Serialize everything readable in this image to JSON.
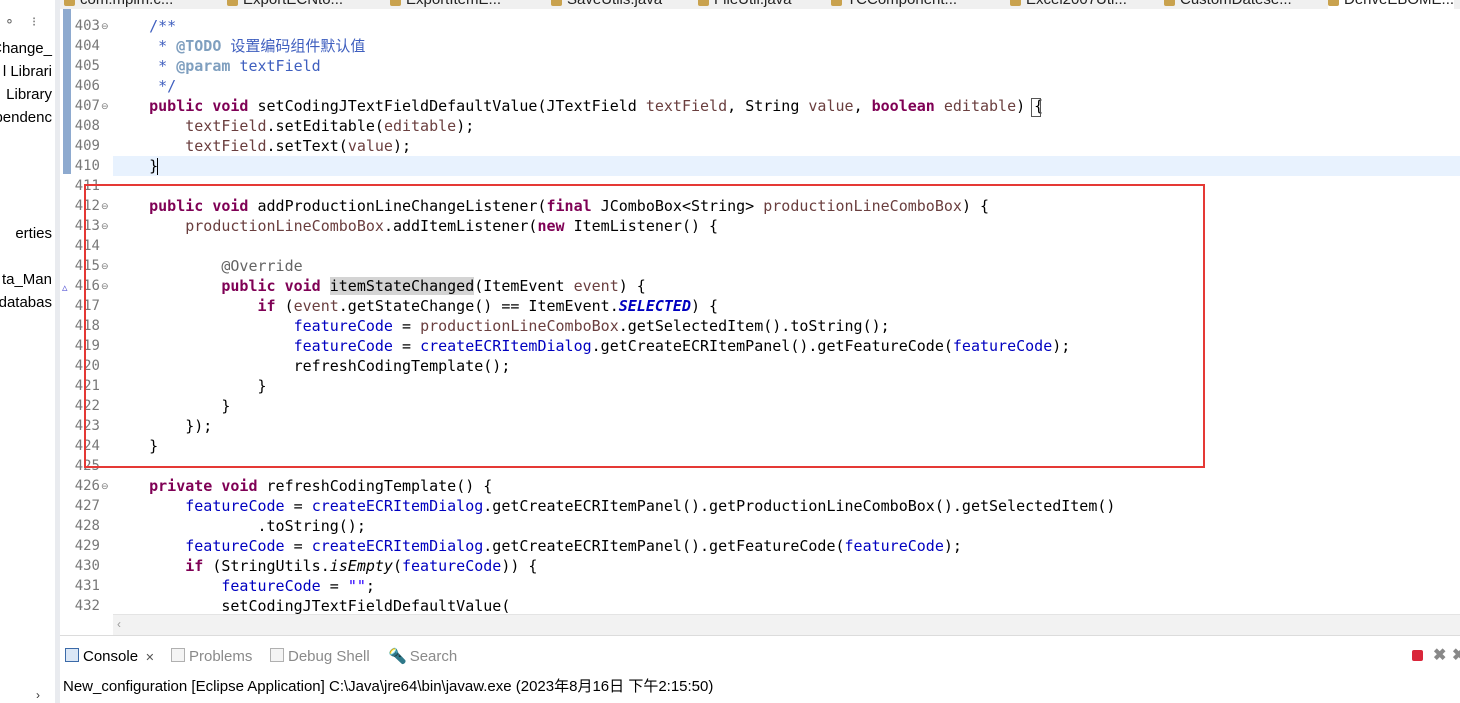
{
  "editor_tabs": [
    {
      "label": "com.mpim.c..."
    },
    {
      "label": "ExportECNto..."
    },
    {
      "label": "ExportItemE..."
    },
    {
      "label": "SaveUtils.java"
    },
    {
      "label": "FileUtil.java"
    },
    {
      "label": "TCComponent..."
    },
    {
      "label": "Excel2007Uti..."
    },
    {
      "label": "CustomDatese..."
    },
    {
      "label": "DeriveEBOME..."
    }
  ],
  "left_tree": [
    {
      "label": "Change_"
    },
    {
      "label": "l Librari"
    },
    {
      "label": "Library"
    },
    {
      "label": "pendenc"
    },
    {
      "label": "erties"
    },
    {
      "label": "ta_Man"
    },
    {
      "label": "databas"
    }
  ],
  "line_numbers": [
    "403",
    "404",
    "405",
    "406",
    "407",
    "408",
    "409",
    "410",
    "411",
    "412",
    "413",
    "414",
    "415",
    "416",
    "417",
    "418",
    "419",
    "420",
    "421",
    "422",
    "423",
    "424",
    "425",
    "426",
    "427",
    "428",
    "429",
    "430",
    "431",
    "432"
  ],
  "code": {
    "l403": "/**",
    "l404_tag": "@TODO",
    "l404_text": "设置编码组件默认值",
    "l405_tag": "@param",
    "l405_param": "textField",
    "l406": "*/",
    "kw_public": "public",
    "kw_void": "void",
    "kw_private": "private",
    "kw_final": "final",
    "kw_new": "new",
    "kw_if": "if",
    "kw_boolean": "boolean",
    "m_setCoding": "setCodingJTextFieldDefaultValue",
    "t_JTextField": "JTextField",
    "t_String": "String",
    "v_textField": "textField",
    "v_value": "value",
    "v_editable": "editable",
    "c_setEditable": ".setEditable(",
    "c_setText": ".setText(",
    "end_stmt": ");",
    "m_addProd": "addProductionLineChangeListener",
    "t_JComboBoxString": "JComboBox<String>",
    "v_prodCombo": "productionLineComboBox",
    "c_addItemListener": ".addItemListener(",
    "t_ItemListener": "ItemListener",
    "a_override": "@Override",
    "m_itemStateChanged": "itemStateChanged",
    "t_ItemEvent": "ItemEvent",
    "v_event": "event",
    "c_getStateChange": ".getStateChange() == ItemEvent.",
    "f_SELECTED": "SELECTED",
    "f_featureCode": "featureCode",
    "f_createDialog": "createECRItemDialog",
    "c_getSelectedToString": ".getSelectedItem().toString();",
    "c_getFeature": ".getCreateECRItemPanel().getFeatureCode(",
    "m_refresh": "refreshCodingTemplate",
    "c_getProdCombo": ".getCreateECRItemPanel().getProductionLineComboBox().getSelectedItem()",
    "c_toString": ".toString();",
    "t_StringUtils": "StringUtils",
    "m_isEmpty": "isEmpty",
    "s_empty": "\"\"",
    "c_setCodingCall": "setCodingJTextFieldDefaultValue("
  },
  "console": {
    "tabs": [
      {
        "label": "Console",
        "close": "✕"
      },
      {
        "label": "Problems"
      },
      {
        "label": "Debug Shell"
      },
      {
        "label": "Search"
      }
    ],
    "launch_line": "New_configuration [Eclipse Application] C:\\Java\\jre64\\bin\\javaw.exe (2023年8月16日 下午2:15:50)"
  }
}
